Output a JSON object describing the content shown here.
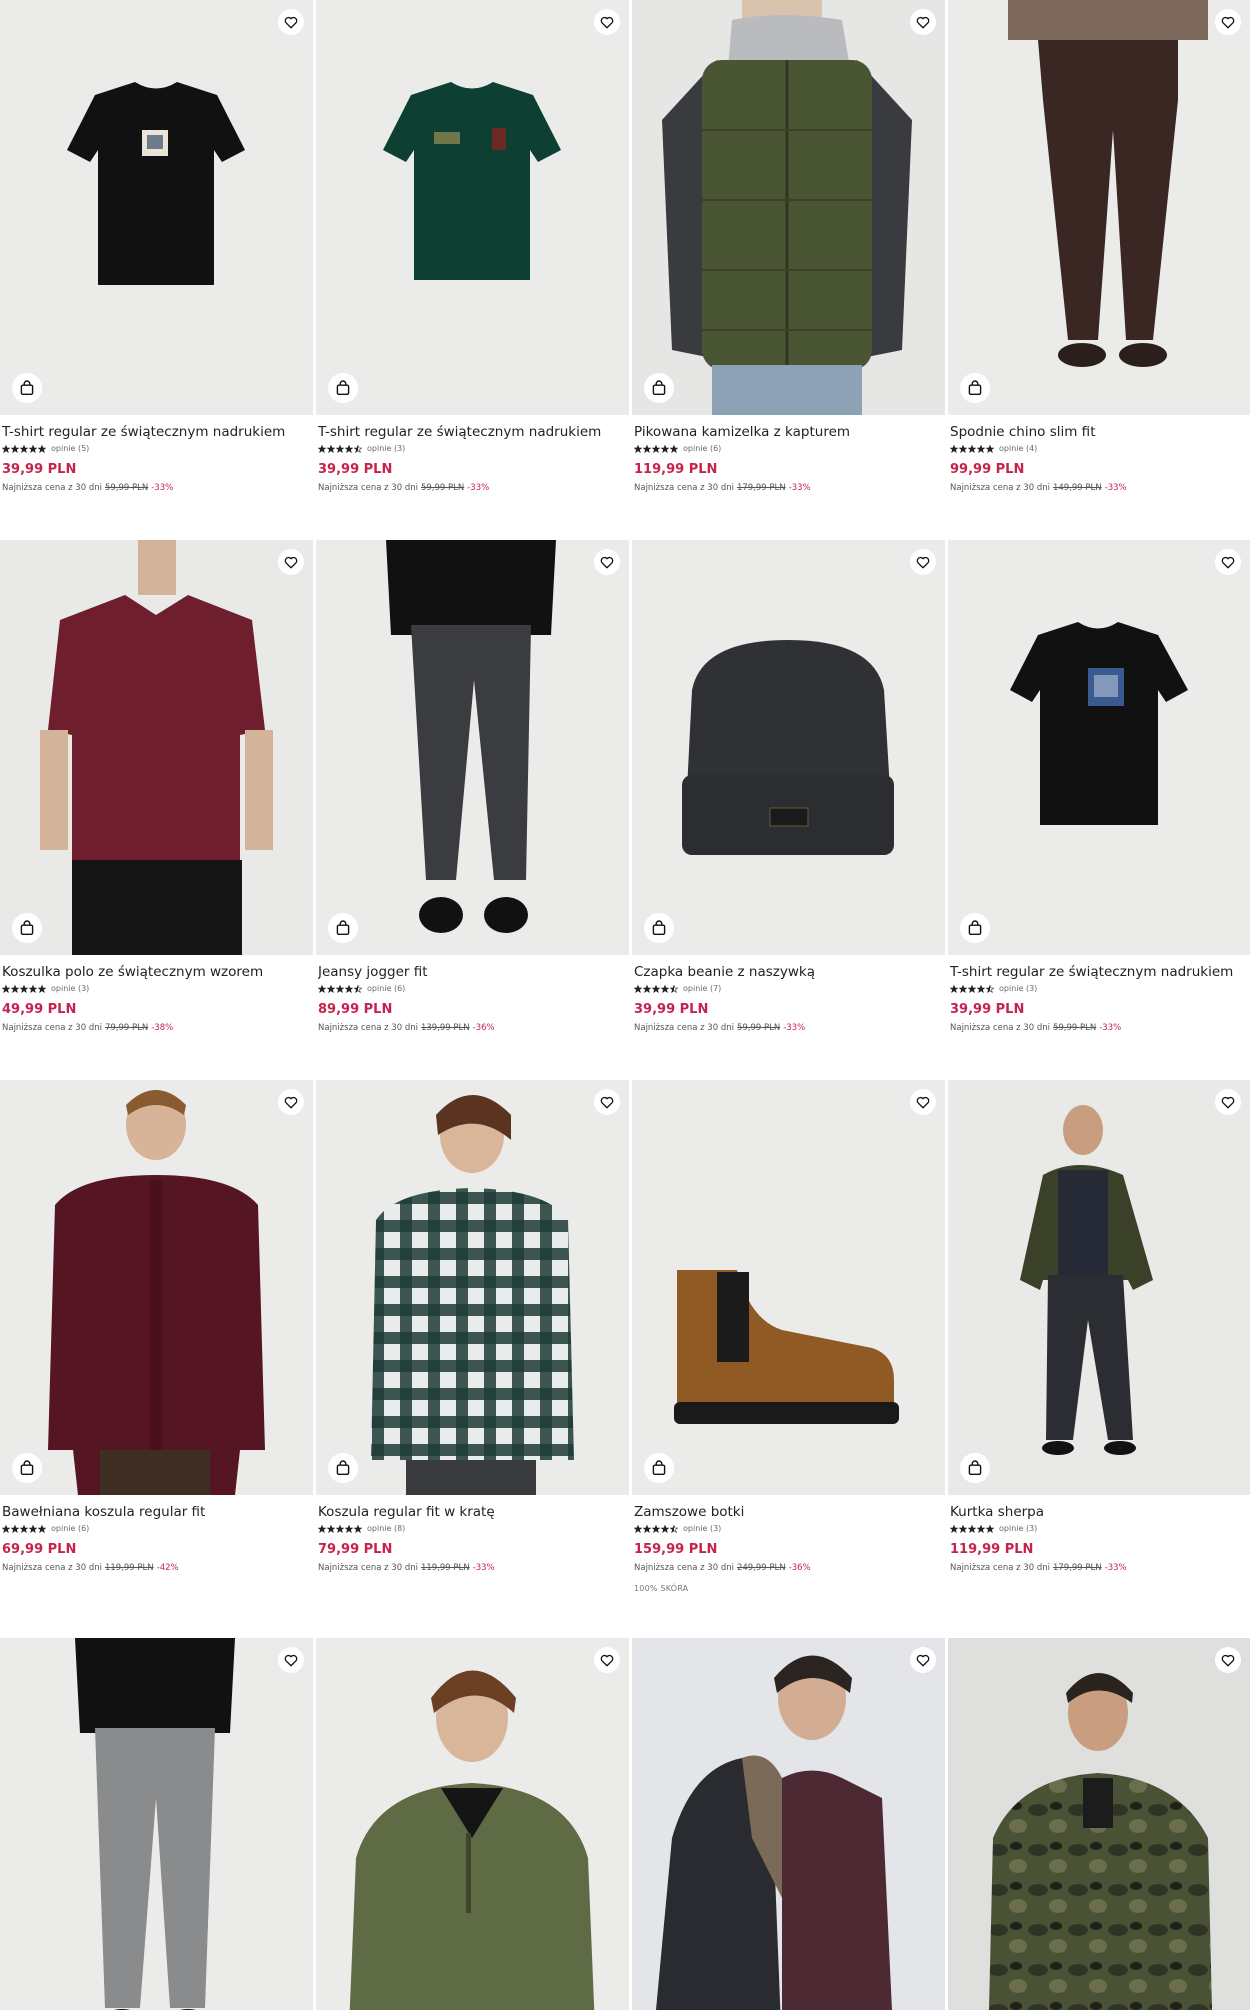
{
  "colors": {
    "accent": "#c4234d",
    "photo_bg": "#ececea"
  },
  "icons": {
    "wishlist": "heart-icon",
    "add_to_bag": "shopping-bag-icon",
    "rating": "star-icon"
  },
  "products": [
    {
      "name": "T-shirt regular ze świątecznym nadrukiem",
      "rating": 5,
      "reviews": "opinie (5)",
      "price": "39,99 PLN",
      "lowest_label": "Najniższa cena z 30 dni",
      "old_price": "59,99 PLN",
      "discount": "-33%"
    },
    {
      "name": "T-shirt regular ze świątecznym nadrukiem",
      "rating": 4.5,
      "reviews": "opinie (3)",
      "price": "39,99 PLN",
      "lowest_label": "Najniższa cena z 30 dni",
      "old_price": "59,99 PLN",
      "discount": "-33%"
    },
    {
      "name": "Pikowana kamizelka z kapturem",
      "rating": 5,
      "reviews": "opinie (6)",
      "price": "119,99 PLN",
      "lowest_label": "Najniższa cena z 30 dni",
      "old_price": "179,99 PLN",
      "discount": "-33%"
    },
    {
      "name": "Spodnie chino slim fit",
      "rating": 5,
      "reviews": "opinie (4)",
      "price": "99,99 PLN",
      "lowest_label": "Najniższa cena z 30 dni",
      "old_price": "149,99 PLN",
      "discount": "-33%"
    },
    {
      "name": "Koszulka polo ze świątecznym wzorem",
      "rating": 5,
      "reviews": "opinie (3)",
      "price": "49,99 PLN",
      "lowest_label": "Najniższa cena z 30 dni",
      "old_price": "79,99 PLN",
      "discount": "-38%"
    },
    {
      "name": "Jeansy jogger fit",
      "rating": 4.5,
      "reviews": "opinie (6)",
      "price": "89,99 PLN",
      "lowest_label": "Najniższa cena z 30 dni",
      "old_price": "139,99 PLN",
      "discount": "-36%"
    },
    {
      "name": "Czapka beanie z naszywką",
      "rating": 4.5,
      "reviews": "opinie (7)",
      "price": "39,99 PLN",
      "lowest_label": "Najniższa cena z 30 dni",
      "old_price": "59,99 PLN",
      "discount": "-33%"
    },
    {
      "name": "T-shirt regular ze świątecznym nadrukiem",
      "rating": 4.5,
      "reviews": "opinie (3)",
      "price": "39,99 PLN",
      "lowest_label": "Najniższa cena z 30 dni",
      "old_price": "59,99 PLN",
      "discount": "-33%"
    },
    {
      "name": "Bawełniana koszula regular fit",
      "rating": 5,
      "reviews": "opinie (6)",
      "price": "69,99 PLN",
      "lowest_label": "Najniższa cena z 30 dni",
      "old_price": "119,99 PLN",
      "discount": "-42%"
    },
    {
      "name": "Koszula regular fit w kratę",
      "rating": 5,
      "reviews": "opinie (8)",
      "price": "79,99 PLN",
      "lowest_label": "Najniższa cena z 30 dni",
      "old_price": "119,99 PLN",
      "discount": "-33%"
    },
    {
      "name": "Zamszowe botki",
      "rating": 4.5,
      "reviews": "opinie (3)",
      "price": "159,99 PLN",
      "lowest_label": "Najniższa cena z 30 dni",
      "old_price": "249,99 PLN",
      "discount": "-36%",
      "material": "100% SKÓRA"
    },
    {
      "name": "Kurtka sherpa",
      "rating": 5,
      "reviews": "opinie (3)",
      "price": "119,99 PLN",
      "lowest_label": "Najniższa cena z 30 dni",
      "old_price": "179,99 PLN",
      "discount": "-33%"
    },
    {
      "name": "",
      "rating": 0,
      "reviews": "",
      "price": "",
      "lowest_label": "",
      "old_price": "",
      "discount": ""
    },
    {
      "name": "",
      "rating": 0,
      "reviews": "",
      "price": "",
      "lowest_label": "",
      "old_price": "",
      "discount": ""
    },
    {
      "name": "",
      "rating": 0,
      "reviews": "",
      "price": "",
      "lowest_label": "",
      "old_price": "",
      "discount": ""
    },
    {
      "name": "",
      "rating": 0,
      "reviews": "",
      "price": "",
      "lowest_label": "",
      "old_price": "",
      "discount": ""
    }
  ]
}
